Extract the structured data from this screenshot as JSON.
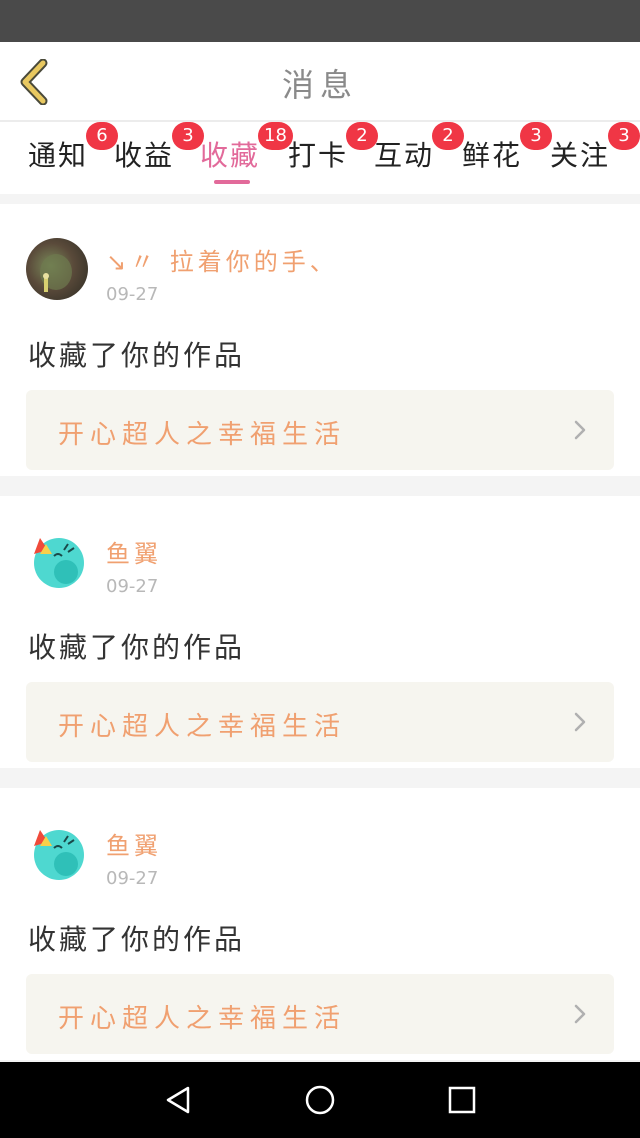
{
  "header": {
    "title": "消息",
    "back_icon": "chevron-left-icon",
    "back_color": "#e0c060"
  },
  "tabs": [
    {
      "label": "通知",
      "badge": "6",
      "active": false
    },
    {
      "label": "收益",
      "badge": "3",
      "active": false
    },
    {
      "label": "收藏",
      "badge": "18",
      "active": true
    },
    {
      "label": "打卡",
      "badge": "2",
      "active": false
    },
    {
      "label": "互动",
      "badge": "2",
      "active": false
    },
    {
      "label": "鲜花",
      "badge": "3",
      "active": false
    },
    {
      "label": "关注",
      "badge": "3",
      "active": false
    }
  ],
  "colors": {
    "accent": "#e26a9a",
    "badge": "#f03645",
    "username": "#f0a070",
    "work_box_bg": "#f6f5ef"
  },
  "messages": [
    {
      "username": "↘〃 拉着你的手、",
      "avatar": "photo-avatar",
      "time": "09-27",
      "action": "收藏了你的作品",
      "work_title": "开心超人之幸福生活"
    },
    {
      "username": "鱼翼",
      "avatar": "cartoon-avatar",
      "time": "09-27",
      "action": "收藏了你的作品",
      "work_title": "开心超人之幸福生活"
    },
    {
      "username": "鱼翼",
      "avatar": "cartoon-avatar",
      "time": "09-27",
      "action": "收藏了你的作品",
      "work_title": "开心超人之幸福生活"
    }
  ],
  "nav": {
    "back_icon": "triangle-back-icon",
    "home_icon": "circle-home-icon",
    "recents_icon": "square-recents-icon"
  }
}
